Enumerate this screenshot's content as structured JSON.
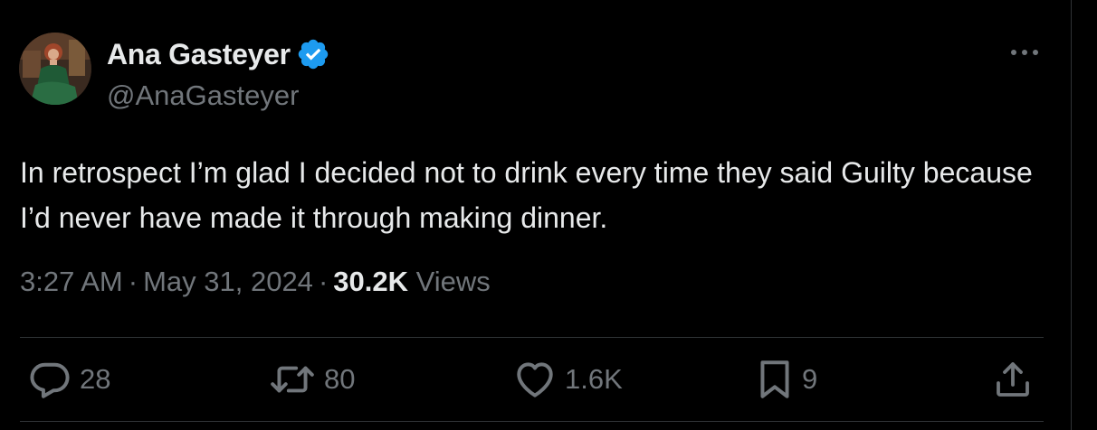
{
  "author": {
    "display_name": "Ana Gasteyer",
    "handle": "@AnaGasteyer",
    "verified": true,
    "verified_color": "#1d9bf0"
  },
  "tweet": {
    "text": "In retrospect I’m glad I decided not to drink every time they said Guilty because I’d never have made it through making dinner.",
    "time": "3:27 AM",
    "date": "May 31, 2024",
    "separator": "·",
    "views_count": "30.2K",
    "views_label": "Views"
  },
  "actions": {
    "replies": "28",
    "reposts": "80",
    "likes": "1.6K",
    "bookmarks": "9"
  },
  "icons": {
    "more": "more-horizontal-icon",
    "reply": "speech-bubble-icon",
    "repost": "repost-arrows-icon",
    "like": "heart-icon",
    "bookmark": "bookmark-icon",
    "share": "share-upload-icon",
    "verified": "verified-badge-icon"
  },
  "colors": {
    "background": "#000000",
    "primary_text": "#e7e9ea",
    "secondary_text": "#71767b",
    "divider": "#2f3336"
  }
}
